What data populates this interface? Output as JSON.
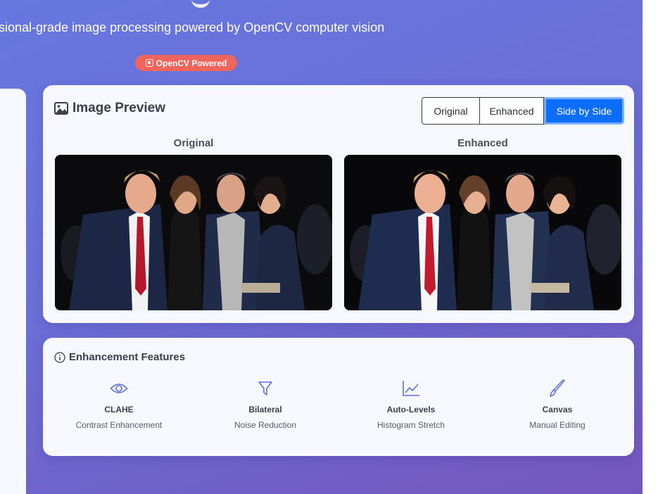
{
  "header": {
    "subtitle": "sional-grade image processing powered by OpenCV computer vision",
    "badge": "OpenCV Powered"
  },
  "preview": {
    "title": "Image Preview",
    "toggle_options": [
      "Original",
      "Enhanced",
      "Side by Side"
    ],
    "active_toggle": "Side by Side",
    "original_label": "Original",
    "enhanced_label": "Enhanced"
  },
  "features": {
    "title": "Enhancement Features",
    "items": [
      {
        "name": "CLAHE",
        "desc": "Contrast Enhancement",
        "icon": "eye-icon"
      },
      {
        "name": "Bilateral",
        "desc": "Noise Reduction",
        "icon": "filter-icon"
      },
      {
        "name": "Auto-Levels",
        "desc": "Histogram Stretch",
        "icon": "chart-line-icon"
      },
      {
        "name": "Canvas",
        "desc": "Manual Editing",
        "icon": "brush-icon"
      }
    ]
  },
  "colors": {
    "accent": "#0d6efd",
    "badge": "#f0645e",
    "icon": "#5b6fd6",
    "background_start": "#6777e0",
    "background_end": "#7457bd"
  }
}
